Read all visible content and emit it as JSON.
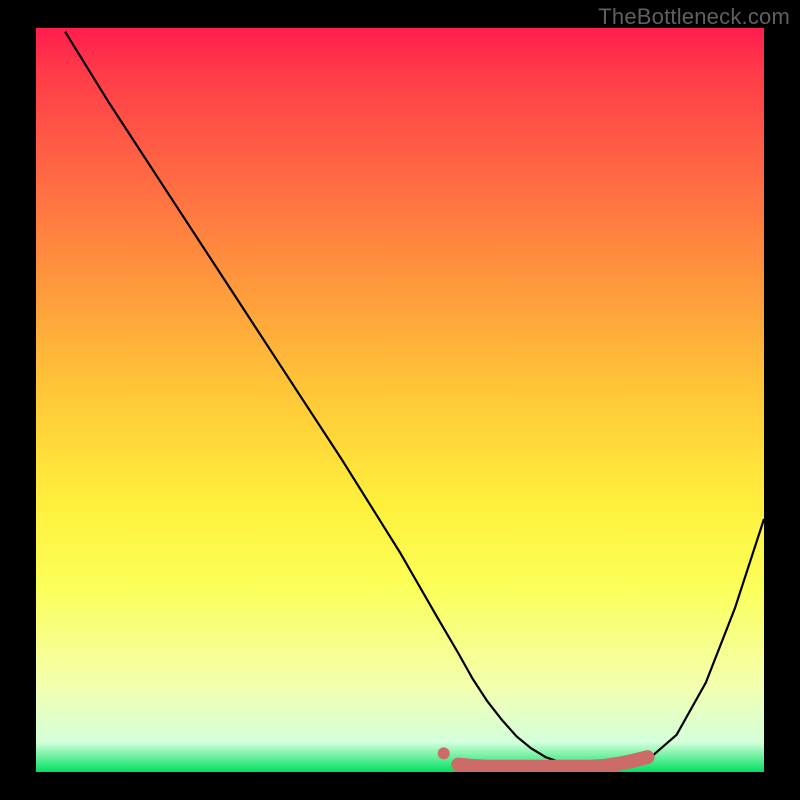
{
  "watermark": "TheBottleneck.com",
  "colors": {
    "curve_line": "#000000",
    "marker": "#cc6b67",
    "gradient_top": "#ff1d4d",
    "gradient_bottom": "#00e060",
    "page_bg": "#000000"
  },
  "chart_data": {
    "type": "line",
    "title": "",
    "xlabel": "",
    "ylabel": "",
    "xlim": [
      0,
      100
    ],
    "ylim": [
      0,
      100
    ],
    "series": [
      {
        "name": "curve",
        "x": [
          4,
          10,
          18,
          26,
          34,
          42,
          50,
          55,
          58,
          60,
          62,
          64,
          66,
          68,
          70,
          72,
          76,
          80,
          84,
          88,
          92,
          96,
          100
        ],
        "values": [
          99.5,
          90,
          78,
          66,
          54,
          42,
          29.5,
          21,
          16,
          12.5,
          9.5,
          7,
          4.8,
          3.2,
          2,
          1.3,
          0.6,
          0.6,
          1.6,
          5,
          12,
          22,
          34
        ]
      }
    ],
    "annotations": {
      "marker_segment": {
        "x_points": [
          58,
          60,
          62,
          64,
          66,
          68,
          70,
          72,
          74,
          76,
          78,
          80,
          82,
          84
        ],
        "y_points": [
          1.0,
          0.8,
          0.7,
          0.7,
          0.7,
          0.7,
          0.7,
          0.7,
          0.7,
          0.7,
          0.8,
          1.1,
          1.5,
          2.0
        ]
      },
      "marker_dot": {
        "x": 56,
        "y": 2.5
      }
    }
  }
}
